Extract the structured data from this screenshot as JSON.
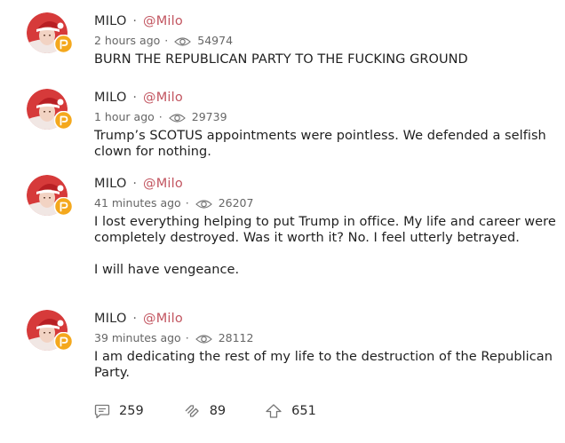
{
  "posts": [
    {
      "name": "MILO",
      "separator": "·",
      "handle": "@Milo",
      "time": "2 hours ago",
      "views": "54974",
      "paragraphs": [
        "BURN THE REPUBLICAN PARTY TO THE FUCKING GROUND"
      ]
    },
    {
      "name": "MILO",
      "separator": "·",
      "handle": "@Milo",
      "time": "1 hour ago",
      "views": "29739",
      "paragraphs": [
        "Trump’s SCOTUS appointments were pointless. We defended a selfish clown for nothing."
      ]
    },
    {
      "name": "MILO",
      "separator": "·",
      "handle": "@Milo",
      "time": "41 minutes ago",
      "views": "26207",
      "paragraphs": [
        "I lost everything helping to put Trump in office. My life and career were completely destroyed. Was it worth it? No. I feel utterly betrayed.",
        "I will have vengeance."
      ]
    },
    {
      "name": "MILO",
      "separator": "·",
      "handle": "@Milo",
      "time": "39 minutes ago",
      "views": "28112",
      "paragraphs": [
        "I am dedicating the rest of my life to the destruction of the Republican Party."
      ]
    }
  ],
  "actions": {
    "comments": "259",
    "echoes": "89",
    "upvotes": "651"
  },
  "colors": {
    "handle": "#c25560",
    "badge": "#f4a81d",
    "muted": "#666666",
    "hat_red": "#d22a2a"
  },
  "icons": {
    "views": "eye-icon",
    "comments": "comment-icon",
    "echoes": "echo-icon",
    "upvotes": "upvote-icon",
    "badge": "parler-badge-icon"
  }
}
